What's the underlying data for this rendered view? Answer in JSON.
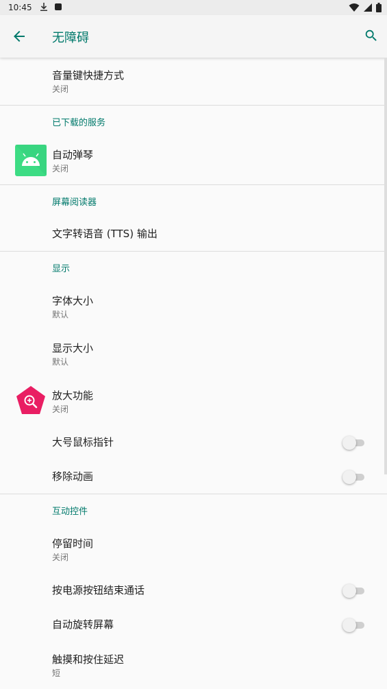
{
  "status_bar": {
    "time": "10:45"
  },
  "app_bar": {
    "title": "无障碍"
  },
  "sections": {
    "top": {
      "volume_shortcut": {
        "title": "音量键快捷方式",
        "summary": "关闭"
      }
    },
    "downloaded": {
      "header": "已下载的服务",
      "auto_piano": {
        "title": "自动弹琴",
        "summary": "关闭"
      }
    },
    "screen_reader": {
      "header": "屏幕阅读器",
      "tts": {
        "title": "文字转语音 (TTS) 输出"
      }
    },
    "display": {
      "header": "显示",
      "font_size": {
        "title": "字体大小",
        "summary": "默认"
      },
      "display_size": {
        "title": "显示大小",
        "summary": "默认"
      },
      "magnification": {
        "title": "放大功能",
        "summary": "关闭"
      },
      "large_pointer": {
        "title": "大号鼠标指针",
        "enabled": false
      },
      "remove_animations": {
        "title": "移除动画",
        "enabled": false
      }
    },
    "interaction": {
      "header": "互动控件",
      "dwell_time": {
        "title": "停留时间",
        "summary": "关闭"
      },
      "power_ends_call": {
        "title": "按电源按钮结束通话",
        "enabled": false
      },
      "auto_rotate": {
        "title": "自动旋转屏幕",
        "enabled": false
      },
      "touch_hold_delay": {
        "title": "触摸和按住延迟",
        "summary": "短"
      }
    }
  },
  "colors": {
    "accent": "#00796b",
    "android_icon_bg": "#3ddc84",
    "magnify_icon": "#e91e63"
  },
  "icons": {
    "back": "arrow-back-icon",
    "search": "search-icon",
    "auto_piano": "android-robot-icon",
    "magnification": "magnify-plus-icon"
  }
}
